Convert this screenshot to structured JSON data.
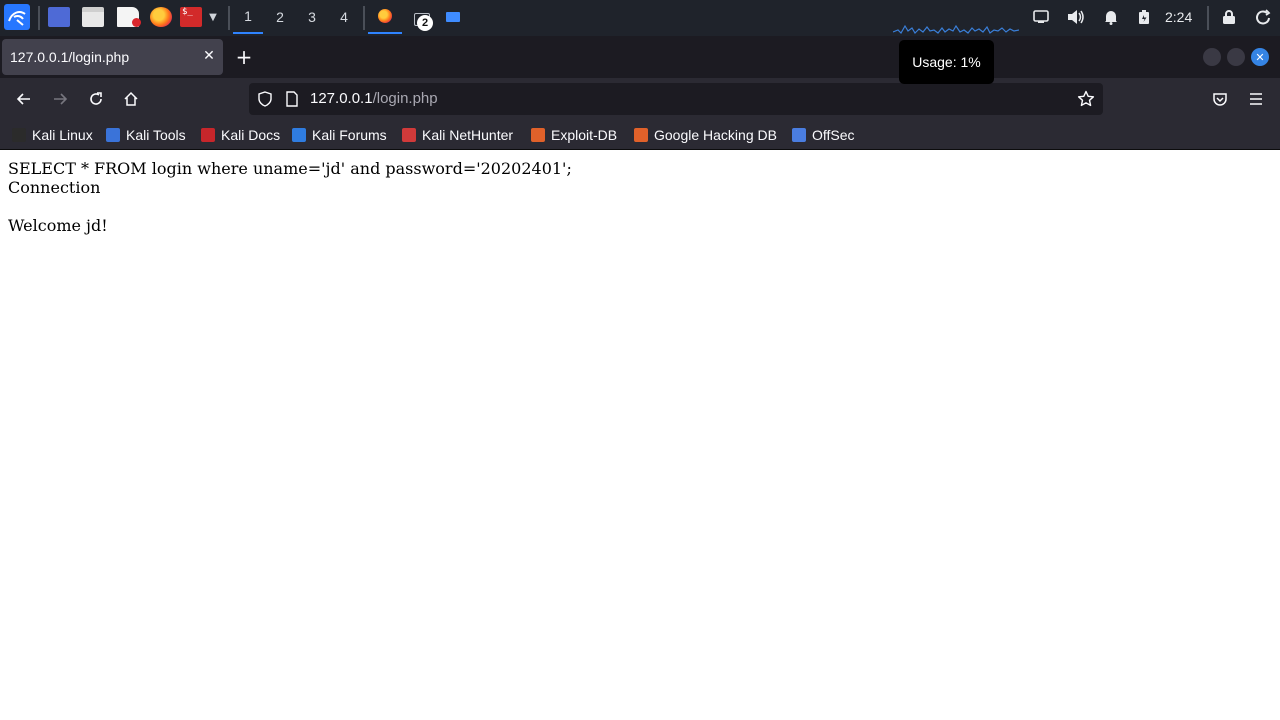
{
  "panel": {
    "workspaces": [
      "1",
      "2",
      "3",
      "4"
    ],
    "active_workspace": "1",
    "terminal_badge": "2",
    "terminal_icon_text": "$_",
    "clock": "2:24",
    "tooltip": "Usage: 1%",
    "icons": [
      "kali-menu-icon",
      "desktop-icon",
      "file-manager-icon",
      "text-editor-icon",
      "firefox-icon",
      "terminal-icon",
      "chevron-down-icon",
      "cpu-graph",
      "display-icon",
      "volume-icon",
      "bell-icon",
      "battery-icon",
      "lock-icon",
      "power-icon"
    ]
  },
  "browser": {
    "tab_title": "127.0.0.1/login.php",
    "url_host": "127.0.0.1",
    "url_path": "/login.php",
    "bookmarks": [
      {
        "label": "Kali Linux",
        "color": "#2b2b2b"
      },
      {
        "label": "Kali Tools",
        "color": "#3a73d9"
      },
      {
        "label": "Kali Docs",
        "color": "#c7262b"
      },
      {
        "label": "Kali Forums",
        "color": "#2f7ce0"
      },
      {
        "label": "Kali NetHunter",
        "color": "#d13a3a"
      },
      {
        "label": "Exploit-DB",
        "color": "#e0612a"
      },
      {
        "label": "Google Hacking DB",
        "color": "#e0612a"
      },
      {
        "label": "OffSec",
        "color": "#4a7de0"
      }
    ]
  },
  "page": {
    "line1": "SELECT * FROM login where uname='jd' and password='20202401';",
    "line2": "Connection",
    "line3": "Welcome jd!"
  },
  "colors": {
    "panel_bg": "#1f232b",
    "tabbar_bg": "#1c1b22",
    "toolbar_bg": "#2b2a33",
    "accent": "#2f83ff"
  }
}
